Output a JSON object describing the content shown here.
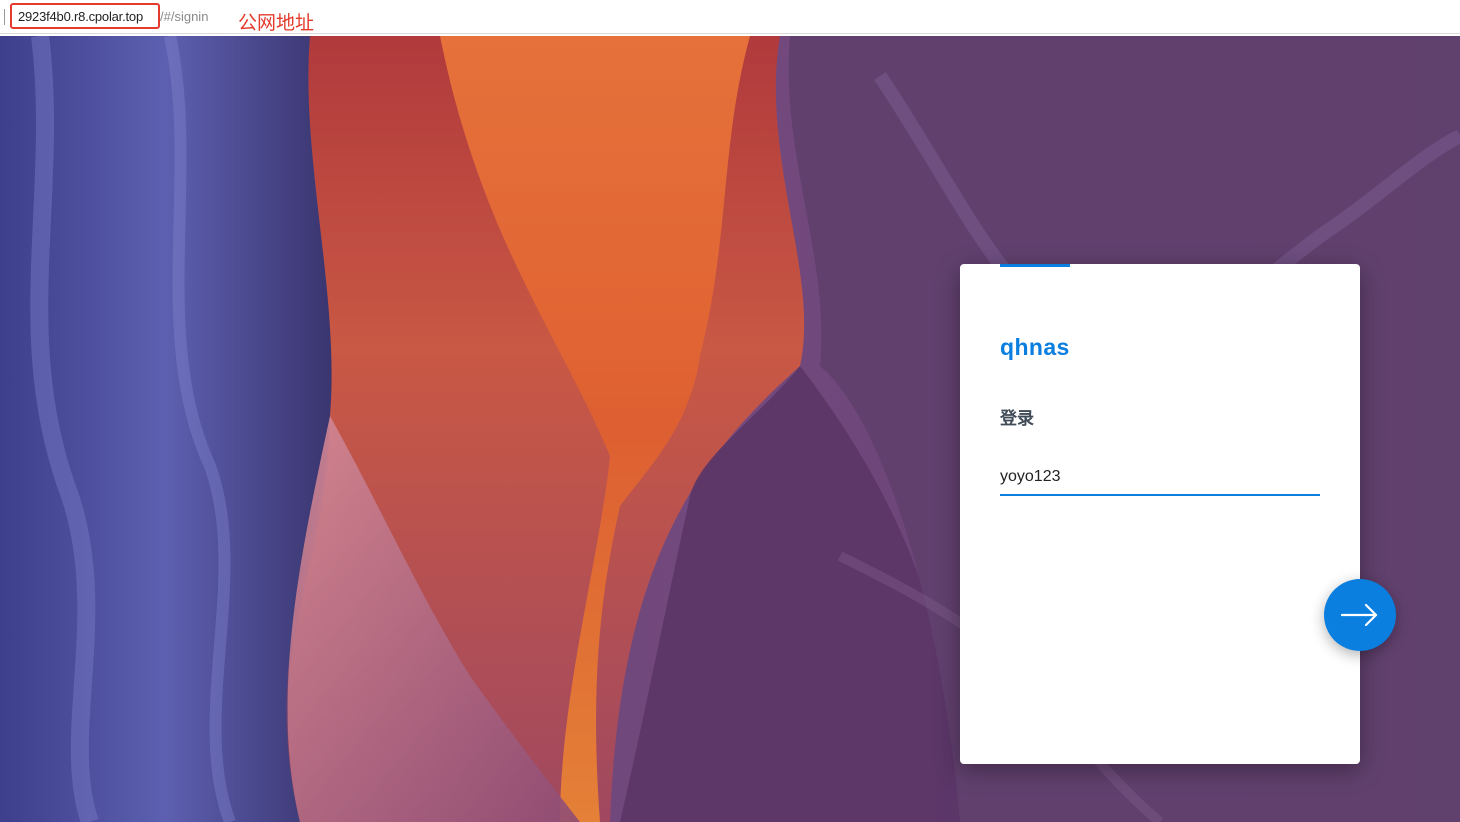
{
  "browser": {
    "url_host": "2923f4b0.r8.cpolar.top",
    "url_path": "/#/signin",
    "annotation": "公网地址"
  },
  "login": {
    "server_name": "qhnas",
    "title": "登录",
    "username_value": "yoyo123"
  },
  "icons": {
    "next": "arrow-right-icon"
  },
  "colors": {
    "accent": "#0a7fe0",
    "annotation": "#e33a2c",
    "label": "#3f4a57"
  }
}
